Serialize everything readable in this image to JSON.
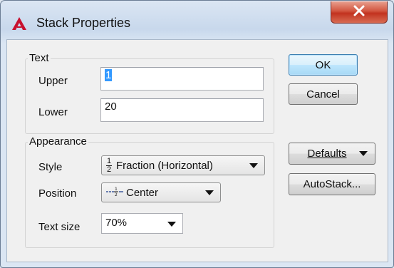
{
  "window": {
    "title": "Stack Properties"
  },
  "text_group": {
    "label": "Text",
    "upper_label": "Upper",
    "upper_value": "1",
    "lower_label": "Lower",
    "lower_value": "20"
  },
  "appearance_group": {
    "label": "Appearance",
    "style_label": "Style",
    "style_value": "Fraction (Horizontal)",
    "position_label": "Position",
    "position_value": "Center",
    "text_size_label": "Text size",
    "text_size_value": "70%"
  },
  "buttons": {
    "ok": "OK",
    "cancel": "Cancel",
    "defaults": "Defaults",
    "autostack": "AutoStack..."
  },
  "colors": {
    "close_button": "#c2321f",
    "default_button_border": "#3c7fb1",
    "selection": "#3399ff",
    "app_icon": "#c8102e"
  }
}
